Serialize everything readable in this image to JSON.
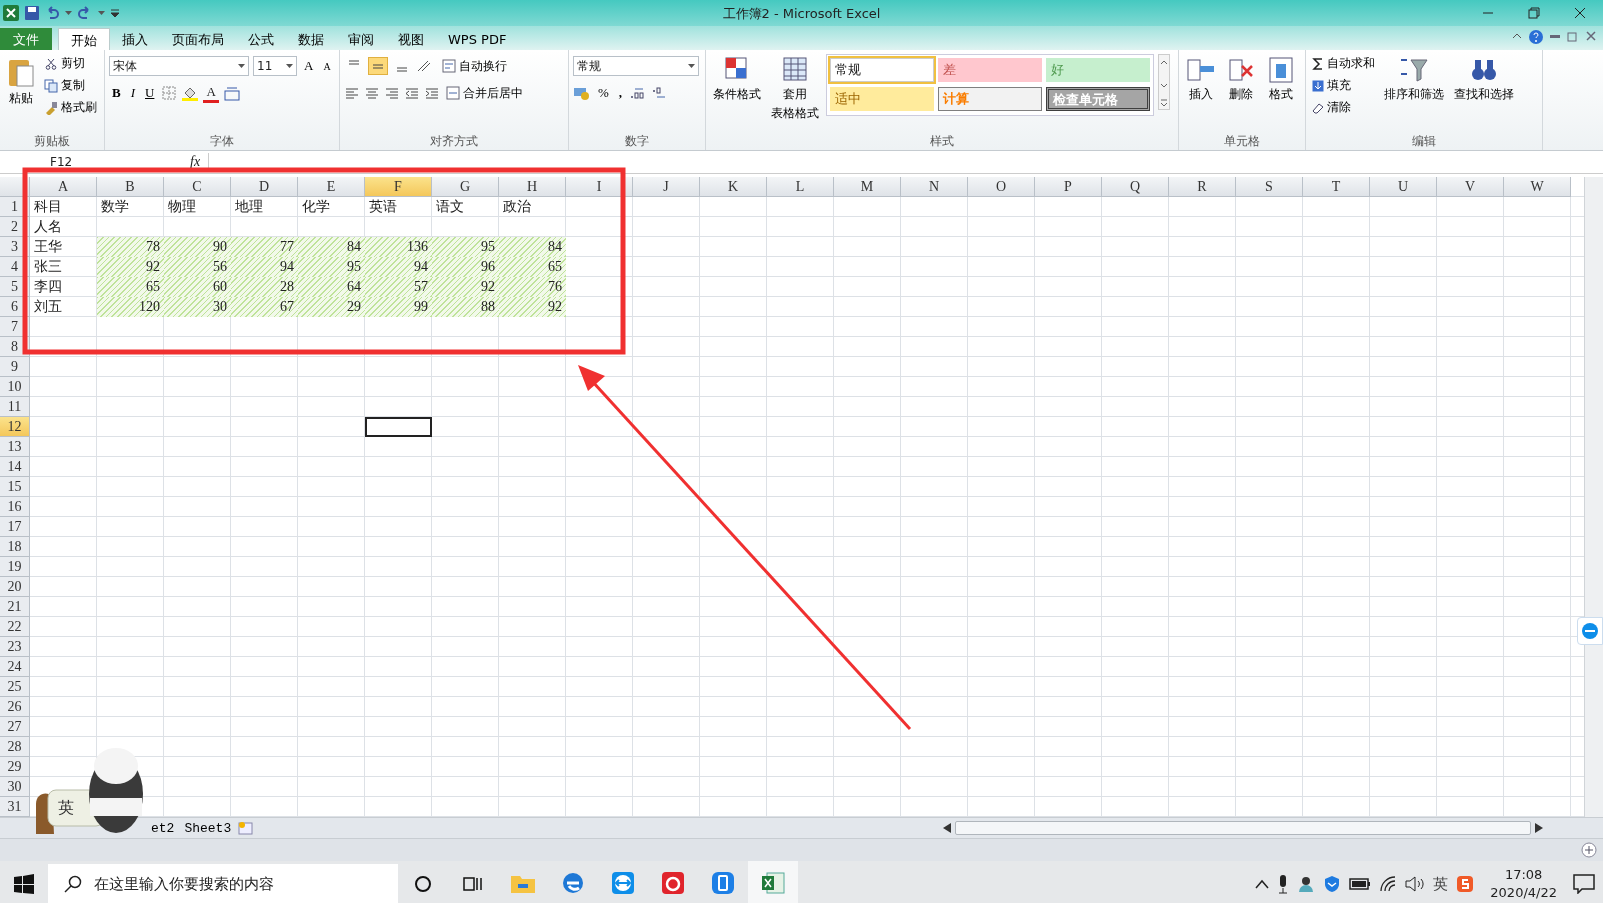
{
  "title_bar": {
    "title": "工作簿2 - Microsoft Excel"
  },
  "menu_tabs": [
    {
      "label": "文件",
      "kind": "file",
      "selected": false
    },
    {
      "label": "开始",
      "kind": "tab",
      "selected": true
    },
    {
      "label": "插入",
      "kind": "tab",
      "selected": false
    },
    {
      "label": "页面布局",
      "kind": "tab",
      "selected": false
    },
    {
      "label": "公式",
      "kind": "tab",
      "selected": false
    },
    {
      "label": "数据",
      "kind": "tab",
      "selected": false
    },
    {
      "label": "审阅",
      "kind": "tab",
      "selected": false
    },
    {
      "label": "视图",
      "kind": "tab",
      "selected": false
    },
    {
      "label": "WPS PDF",
      "kind": "tab",
      "selected": false
    }
  ],
  "ribbon": {
    "clipboard": {
      "label": "剪贴板",
      "paste": "粘贴",
      "cut": "剪切",
      "copy": "复制",
      "format_painter": "格式刷"
    },
    "font": {
      "label": "字体",
      "family": "宋体",
      "size": "11",
      "grow": "A",
      "shrink": "A",
      "bold": "B",
      "italic": "I",
      "underline": "U",
      "font_color": "A"
    },
    "alignment": {
      "label": "对齐方式",
      "vertical_align": [
        {
          "kind": "top",
          "selected": false
        },
        {
          "kind": "middle",
          "selected": true
        },
        {
          "kind": "bottom",
          "selected": false
        }
      ],
      "wrap": "自动换行",
      "merge": "合并后居中"
    },
    "number": {
      "label": "数字",
      "format": "常规",
      "percent": "%",
      "comma": ","
    },
    "styles": {
      "label": "样式",
      "conditional": "条件格式",
      "table_format": [
        "套用",
        "表格格式"
      ],
      "gallery": [
        {
          "label": "常规",
          "kind": "normal",
          "selected": true
        },
        {
          "label": "差",
          "kind": "bad",
          "selected": false
        },
        {
          "label": "好",
          "kind": "good",
          "selected": false
        },
        {
          "label": "适中",
          "kind": "neutral",
          "selected": false
        },
        {
          "label": "计算",
          "kind": "calculation",
          "selected": false
        },
        {
          "label": "检查单元格",
          "kind": "check",
          "selected": false
        }
      ]
    },
    "cells": {
      "label": "单元格",
      "buttons": [
        {
          "label": "插入",
          "kind": "insert"
        },
        {
          "label": "删除",
          "kind": "delete"
        },
        {
          "label": "格式",
          "kind": "format"
        }
      ]
    },
    "editing": {
      "label": "编辑",
      "autosum": "自动求和",
      "fill": "填充",
      "clear": "清除",
      "sort": "排序和筛选",
      "find": "查找和选择"
    }
  },
  "formula_bar": {
    "name_box": "F12",
    "fx": "fx"
  },
  "sheet": {
    "columns": [
      {
        "label": "A",
        "selected": false
      },
      {
        "label": "B",
        "selected": false
      },
      {
        "label": "C",
        "selected": false
      },
      {
        "label": "D",
        "selected": false
      },
      {
        "label": "E",
        "selected": false
      },
      {
        "label": "F",
        "selected": true
      },
      {
        "label": "G",
        "selected": false
      },
      {
        "label": "H",
        "selected": false
      },
      {
        "label": "I",
        "selected": false
      },
      {
        "label": "J",
        "selected": false
      },
      {
        "label": "K",
        "selected": false
      },
      {
        "label": "L",
        "selected": false
      },
      {
        "label": "M",
        "selected": false
      },
      {
        "label": "N",
        "selected": false
      },
      {
        "label": "O",
        "selected": false
      },
      {
        "label": "P",
        "selected": false
      },
      {
        "label": "Q",
        "selected": false
      },
      {
        "label": "R",
        "selected": false
      },
      {
        "label": "S",
        "selected": false
      },
      {
        "label": "T",
        "selected": false
      },
      {
        "label": "U",
        "selected": false
      },
      {
        "label": "V",
        "selected": false
      },
      {
        "label": "W",
        "selected": false
      }
    ],
    "rows": [
      {
        "label": "1",
        "selected": false,
        "cells": [
          "科目",
          "数学",
          "物理",
          "地理",
          "化学",
          "英语",
          "语文",
          "政治"
        ]
      },
      {
        "label": "2",
        "selected": false,
        "cells": [
          "人名"
        ]
      },
      {
        "label": "3",
        "selected": false,
        "shaded": true,
        "cells": [
          "王华",
          "78",
          "90",
          "77",
          "84",
          "136",
          "95",
          "84"
        ]
      },
      {
        "label": "4",
        "selected": false,
        "shaded": true,
        "cells": [
          "张三",
          "92",
          "56",
          "94",
          "95",
          "94",
          "96",
          "65"
        ]
      },
      {
        "label": "5",
        "selected": false,
        "shaded": true,
        "cells": [
          "李四",
          "65",
          "60",
          "28",
          "64",
          "57",
          "92",
          "76"
        ]
      },
      {
        "label": "6",
        "selected": false,
        "shaded": true,
        "cells": [
          "刘五",
          "120",
          "30",
          "67",
          "29",
          "99",
          "88",
          "92"
        ]
      },
      {
        "label": "7",
        "selected": false
      },
      {
        "label": "8",
        "selected": false
      },
      {
        "label": "9",
        "selected": false
      },
      {
        "label": "10",
        "selected": false
      },
      {
        "label": "11",
        "selected": false
      },
      {
        "label": "12",
        "selected": true
      },
      {
        "label": "13",
        "selected": false
      },
      {
        "label": "14",
        "selected": false
      },
      {
        "label": "15",
        "selected": false
      },
      {
        "label": "16",
        "selected": false
      },
      {
        "label": "17",
        "selected": false
      },
      {
        "label": "18",
        "selected": false
      },
      {
        "label": "19",
        "selected": false
      },
      {
        "label": "20",
        "selected": false
      },
      {
        "label": "21",
        "selected": false
      },
      {
        "label": "22",
        "selected": false
      },
      {
        "label": "23",
        "selected": false
      },
      {
        "label": "24",
        "selected": false
      },
      {
        "label": "25",
        "selected": false
      },
      {
        "label": "26",
        "selected": false
      },
      {
        "label": "27",
        "selected": false
      },
      {
        "label": "28",
        "selected": false
      },
      {
        "label": "29",
        "selected": false
      },
      {
        "label": "30",
        "selected": false
      },
      {
        "label": "31",
        "selected": false
      }
    ],
    "sheet_tabs": [
      "et2",
      "Sheet3"
    ]
  },
  "ime_sticker": {
    "label": "英"
  },
  "taskbar": {
    "search": {
      "placeholder": "在这里输入你要搜索的内容"
    },
    "apps": [
      {
        "kind": "explorer"
      },
      {
        "kind": "edge"
      },
      {
        "kind": "remote"
      },
      {
        "kind": "music"
      },
      {
        "kind": "phone"
      },
      {
        "kind": "excel"
      }
    ],
    "ime": "英",
    "time": "17:08",
    "date": "2020/4/22"
  }
}
